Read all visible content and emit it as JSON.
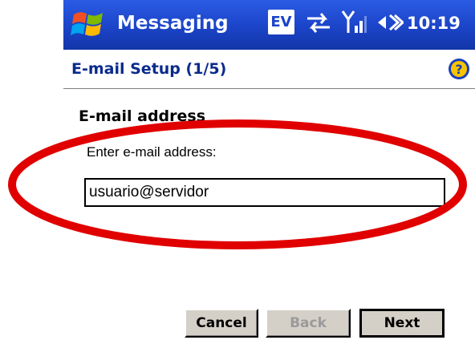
{
  "titlebar": {
    "app_title": "Messaging",
    "ev_label": "EV",
    "time": "10:19",
    "icons": [
      "windows-start-flag",
      "sync-arrows",
      "signal-strength",
      "volume"
    ],
    "background_color": "#1b44c8"
  },
  "header": {
    "title": "E-mail Setup (1/5)",
    "help_icon": "help-question-icon",
    "title_color": "#0a2b8c"
  },
  "form": {
    "section_heading": "E-mail address",
    "field_label": "Enter e-mail address:",
    "email_value": "usuario@servidor"
  },
  "annotation": {
    "shape": "ellipse",
    "color": "#e00000"
  },
  "buttons": {
    "cancel": "Cancel",
    "back": "Back",
    "next": "Next",
    "back_disabled": true
  }
}
